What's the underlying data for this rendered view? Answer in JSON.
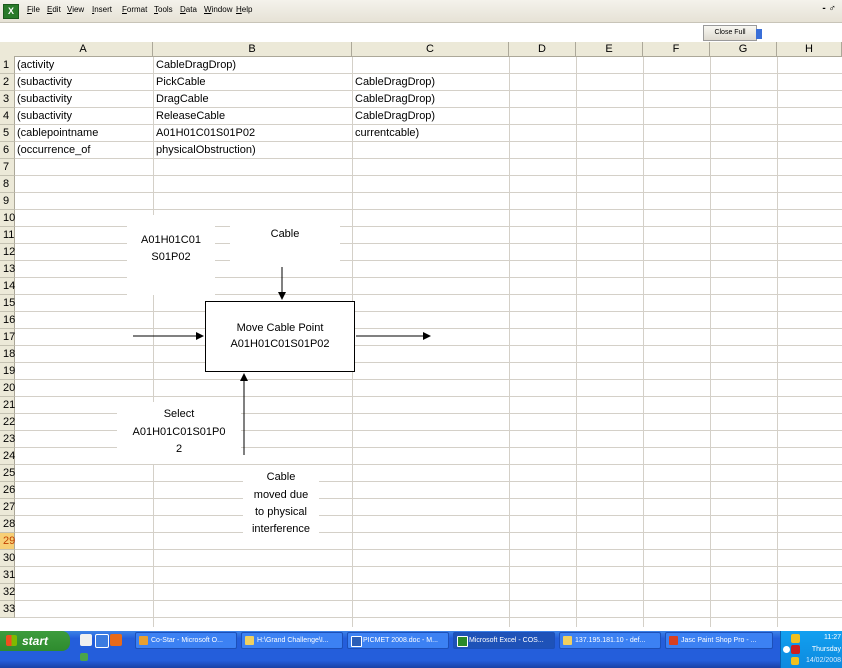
{
  "menu": [
    "File",
    "Edit",
    "View",
    "Insert",
    "Format",
    "Tools",
    "Data",
    "Window",
    "Help"
  ],
  "fullscreen_button": "Close Full Screen",
  "window_controls": "- ♂",
  "columns": [
    "A",
    "B",
    "C",
    "D",
    "E",
    "F",
    "G",
    "H"
  ],
  "rows": [
    "1",
    "2",
    "3",
    "4",
    "5",
    "6",
    "7",
    "8",
    "9",
    "10",
    "11",
    "12",
    "13",
    "14",
    "15",
    "16",
    "17",
    "18",
    "19",
    "20",
    "21",
    "22",
    "23",
    "24",
    "25",
    "26",
    "27",
    "28",
    "29",
    "30",
    "31",
    "32",
    "33"
  ],
  "cells": [
    [
      "(activity",
      "CableDragDrop)",
      ""
    ],
    [
      "(subactivity",
      "PickCable",
      "CableDragDrop)"
    ],
    [
      "(subactivity",
      "DragCable",
      "CableDragDrop)"
    ],
    [
      "(subactivity",
      "ReleaseCable",
      "CableDragDrop)"
    ],
    [
      "(cablepointname",
      "A01H01C01S01P02",
      "currentcable)"
    ],
    [
      "(occurrence_of",
      "physicalObstruction)",
      ""
    ]
  ],
  "diagram": {
    "input_label_1": "A01H01C01",
    "input_label_2": "S01P02",
    "control_label": "Cable",
    "process_line1": "Move Cable Point",
    "process_line2": "A01H01C01S01P02",
    "mechanism_line1": "Select",
    "mechanism_line2": "A01H01C01S01P0",
    "mechanism_line3": "2",
    "note_line1": "Cable",
    "note_line2": "moved due",
    "note_line3": "to physical",
    "note_line4": "interference"
  },
  "taskbar": {
    "start": "start",
    "tasks": [
      "Co-Star - Microsoft O...",
      "H:\\Grand Challenge\\I...",
      "PICMET 2008.doc - M...",
      "Microsoft Excel - COS...",
      "137.195.181.10 - def...",
      "Jasc Paint Shop Pro - ..."
    ],
    "clock": "11:27",
    "day": "Thursday",
    "date": "14/02/2008"
  },
  "colors": {
    "taskbar": "#245edb",
    "start": "#2e8b2e",
    "active_row_header": "#f7cf75"
  }
}
